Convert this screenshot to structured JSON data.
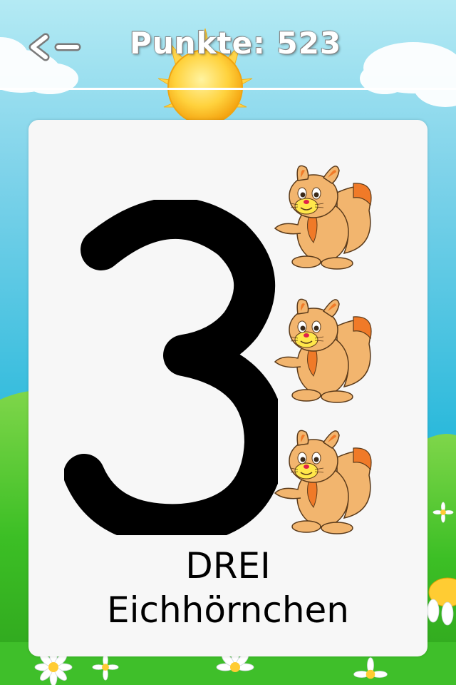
{
  "header": {
    "back_icon": "back-arrow-icon",
    "score_text": "Punkte: 523"
  },
  "flashcard": {
    "number_glyph": "3",
    "number_word": "DREI",
    "object_word": "Eichhörnchen",
    "object_icon": "squirrel-icon",
    "object_count": 3
  },
  "colors": {
    "sky_top": "#a8e4f0",
    "sky_bottom": "#1fb6d8",
    "grass": "#3fbf2a",
    "sun": "#ffc933",
    "card": "#f7f7f7",
    "text": "#000000",
    "squirrel_fur": "#f2b56e",
    "squirrel_tail": "#f07a28"
  }
}
